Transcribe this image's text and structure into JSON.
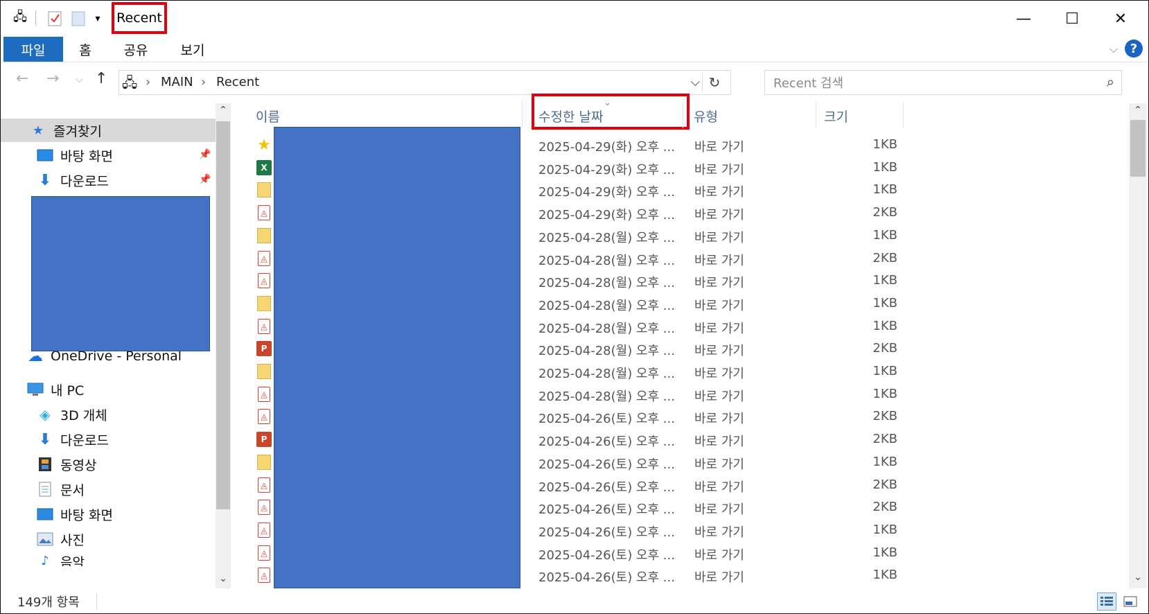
{
  "window": {
    "title": "Recent",
    "controls": {
      "minimize": "—",
      "maximize": "☐",
      "close": "✕"
    }
  },
  "ribbon": {
    "tabs": [
      "파일",
      "홈",
      "공유",
      "보기"
    ],
    "help": "?"
  },
  "address": {
    "crumbs": [
      "MAIN",
      "Recent"
    ],
    "search_placeholder": "Recent 검색"
  },
  "nav": {
    "favorites": "즐겨찾기",
    "pinned": [
      "바탕 화면",
      "다운로드"
    ],
    "onedrive": "OneDrive - Personal",
    "thispc": "내 PC",
    "thispc_items": [
      "3D 개체",
      "다운로드",
      "동영상",
      "문서",
      "바탕 화면",
      "사진",
      "음악"
    ]
  },
  "columns": {
    "name": "이름",
    "date": "수정한 날짜",
    "type": "유형",
    "size": "크기"
  },
  "files": [
    {
      "icon": "star",
      "date": "2025-04-29(화) 오후 ...",
      "type": "바로 가기",
      "size": "1KB"
    },
    {
      "icon": "xls",
      "date": "2025-04-29(화) 오후 ...",
      "type": "바로 가기",
      "size": "1KB"
    },
    {
      "icon": "folder",
      "date": "2025-04-29(화) 오후 ...",
      "type": "바로 가기",
      "size": "1KB"
    },
    {
      "icon": "pdf",
      "date": "2025-04-29(화) 오후 ...",
      "type": "바로 가기",
      "size": "2KB"
    },
    {
      "icon": "folder",
      "date": "2025-04-28(월) 오후 ...",
      "type": "바로 가기",
      "size": "1KB"
    },
    {
      "icon": "pdf",
      "date": "2025-04-28(월) 오후 ...",
      "type": "바로 가기",
      "size": "2KB"
    },
    {
      "icon": "pdf",
      "date": "2025-04-28(월) 오후 ...",
      "type": "바로 가기",
      "size": "1KB"
    },
    {
      "icon": "folder",
      "date": "2025-04-28(월) 오후 ...",
      "type": "바로 가기",
      "size": "1KB"
    },
    {
      "icon": "pdf",
      "date": "2025-04-28(월) 오후 ...",
      "type": "바로 가기",
      "size": "1KB"
    },
    {
      "icon": "ppt",
      "date": "2025-04-28(월) 오후 ...",
      "type": "바로 가기",
      "size": "2KB"
    },
    {
      "icon": "folder",
      "date": "2025-04-28(월) 오후 ...",
      "type": "바로 가기",
      "size": "1KB"
    },
    {
      "icon": "pdf",
      "date": "2025-04-28(월) 오후 ...",
      "type": "바로 가기",
      "size": "1KB"
    },
    {
      "icon": "pdf",
      "date": "2025-04-26(토) 오후 ...",
      "type": "바로 가기",
      "size": "2KB"
    },
    {
      "icon": "ppt",
      "date": "2025-04-26(토) 오후 ...",
      "type": "바로 가기",
      "size": "2KB"
    },
    {
      "icon": "folder",
      "date": "2025-04-26(토) 오후 ...",
      "type": "바로 가기",
      "size": "1KB"
    },
    {
      "icon": "pdf",
      "date": "2025-04-26(토) 오후 ...",
      "type": "바로 가기",
      "size": "2KB"
    },
    {
      "icon": "pdf",
      "date": "2025-04-26(토) 오후 ...",
      "type": "바로 가기",
      "size": "2KB"
    },
    {
      "icon": "pdf",
      "date": "2025-04-26(토) 오후 ...",
      "type": "바로 가기",
      "size": "1KB"
    },
    {
      "icon": "pdf",
      "date": "2025-04-26(토) 오후 ...",
      "type": "바로 가기",
      "size": "1KB"
    },
    {
      "icon": "pdf",
      "date": "2025-04-26(토) 오후 ...",
      "type": "바로 가기",
      "size": "1KB"
    }
  ],
  "status": {
    "count": "149개 항목"
  },
  "colors": {
    "accent": "#1e6cbf",
    "redaction": "#4472c4",
    "highlight": "#e3000f",
    "header_text": "#4d6b8f"
  }
}
